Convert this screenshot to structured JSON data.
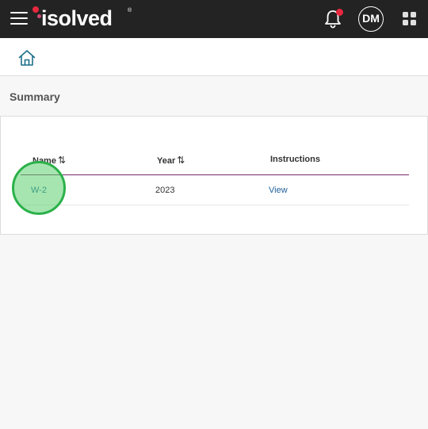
{
  "header": {
    "brand": "isolved",
    "trademark": "®",
    "avatar_initials": "DM",
    "colors": {
      "bar": "#232323",
      "notification_dot": "#e8283e",
      "accent_line": "#7a2a6b",
      "link": "#1d5f9a"
    },
    "icons": [
      "hamburger-icon",
      "bell-icon",
      "apps-grid-icon"
    ]
  },
  "breadcrumb": {
    "icon": "home-icon"
  },
  "main": {
    "section_title": "Summary",
    "table": {
      "columns": [
        {
          "label": "Name",
          "sortable": true,
          "sort_glyph": "⇅"
        },
        {
          "label": "Year",
          "sortable": true,
          "sort_glyph": "⇅"
        },
        {
          "label": "Instructions",
          "sortable": false
        }
      ],
      "rows": [
        {
          "name": "W-2",
          "year": "2023",
          "instructions": "View"
        }
      ]
    }
  }
}
